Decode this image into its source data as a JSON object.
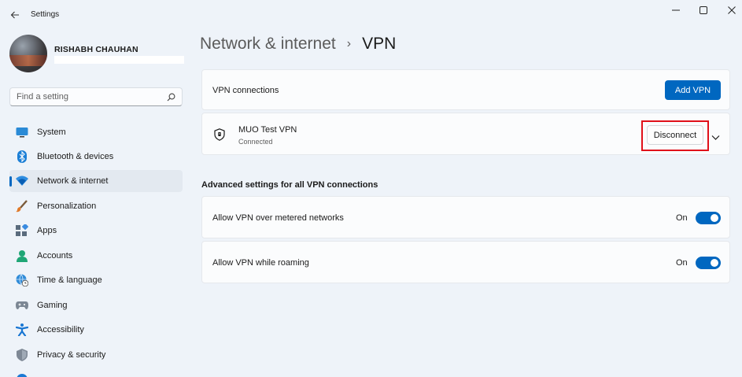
{
  "window": {
    "title": "Settings",
    "back_icon": "back-arrow-icon",
    "minimize_icon": "minimize-icon",
    "maximize_icon": "maximize-icon",
    "close_icon": "close-icon"
  },
  "profile": {
    "name": "RISHABH CHAUHAN"
  },
  "search": {
    "placeholder": "Find a setting",
    "value": "",
    "icon": "search-icon"
  },
  "sidebar": {
    "items": [
      {
        "label": "System",
        "icon": "system-icon",
        "active": false
      },
      {
        "label": "Bluetooth & devices",
        "icon": "bluetooth-icon",
        "active": false
      },
      {
        "label": "Network & internet",
        "icon": "wifi-icon",
        "active": true
      },
      {
        "label": "Personalization",
        "icon": "paintbrush-icon",
        "active": false
      },
      {
        "label": "Apps",
        "icon": "apps-icon",
        "active": false
      },
      {
        "label": "Accounts",
        "icon": "account-icon",
        "active": false
      },
      {
        "label": "Time & language",
        "icon": "globe-clock-icon",
        "active": false
      },
      {
        "label": "Gaming",
        "icon": "gamepad-icon",
        "active": false
      },
      {
        "label": "Accessibility",
        "icon": "accessibility-icon",
        "active": false
      },
      {
        "label": "Privacy & security",
        "icon": "shield-icon",
        "active": false
      }
    ]
  },
  "breadcrumb": {
    "parent": "Network & internet",
    "separator": "›",
    "current": "VPN"
  },
  "vpn_connections": {
    "label": "VPN connections",
    "add_button": "Add VPN"
  },
  "vpn_item": {
    "name": "MUO Test VPN",
    "status": "Connected",
    "disconnect_button": "Disconnect",
    "icon": "vpn-shield-icon",
    "expand_icon": "chevron-down-icon"
  },
  "advanced": {
    "title": "Advanced settings for all VPN connections",
    "settings": [
      {
        "label": "Allow VPN over metered networks",
        "state": "On",
        "enabled": true
      },
      {
        "label": "Allow VPN while roaming",
        "state": "On",
        "enabled": true
      }
    ]
  },
  "colors": {
    "accent": "#0067c0",
    "background": "#eef3f9",
    "highlight": "#e0101a"
  }
}
